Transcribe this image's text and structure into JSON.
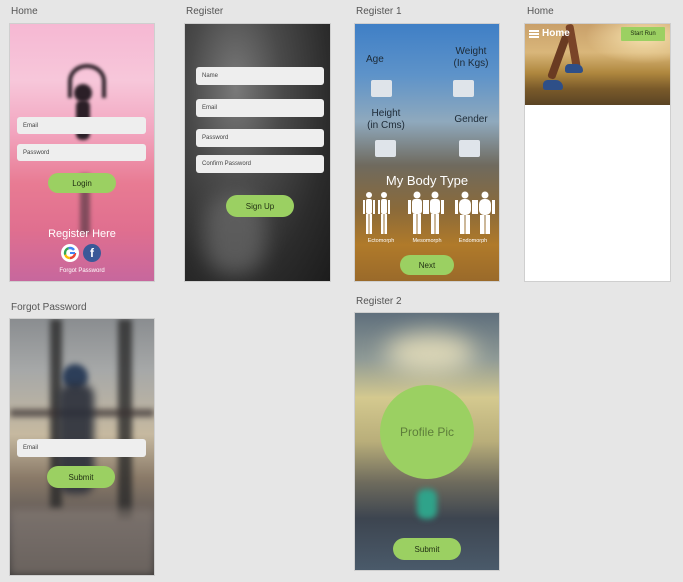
{
  "labels": {
    "home1": "Home",
    "register": "Register",
    "register1": "Register 1",
    "home2": "Home",
    "forgot": "Forgot Password",
    "register2": "Register 2"
  },
  "home_login": {
    "email_placeholder": "Email",
    "password_placeholder": "Password",
    "login_label": "Login",
    "register_here": "Register Here",
    "forgot_password": "Forgot Password",
    "icons": [
      "google-icon",
      "facebook-icon"
    ]
  },
  "register": {
    "name_placeholder": "Name",
    "email_placeholder": "Email",
    "password_placeholder": "Password",
    "confirm_placeholder": "Confirm Password",
    "signup_label": "Sign Up"
  },
  "register1": {
    "age": "Age",
    "weight": "Weight\n(In Kgs)",
    "height": "Height\n(in Cms)",
    "gender": "Gender",
    "body_type_title": "My Body Type",
    "types": [
      "Ectomorph",
      "Mesomorph",
      "Endomorph"
    ],
    "next_label": "Next"
  },
  "home_main": {
    "title": "Home",
    "start_run_label": "Start Run",
    "icons": [
      "menu-icon"
    ]
  },
  "forgot": {
    "email_placeholder": "Email",
    "submit_label": "Submit"
  },
  "register2": {
    "profile_pic_label": "Profile Pic",
    "submit_label": "Submit"
  },
  "colors": {
    "accent": "#9bd062",
    "canvas": "#e6e6e6"
  }
}
